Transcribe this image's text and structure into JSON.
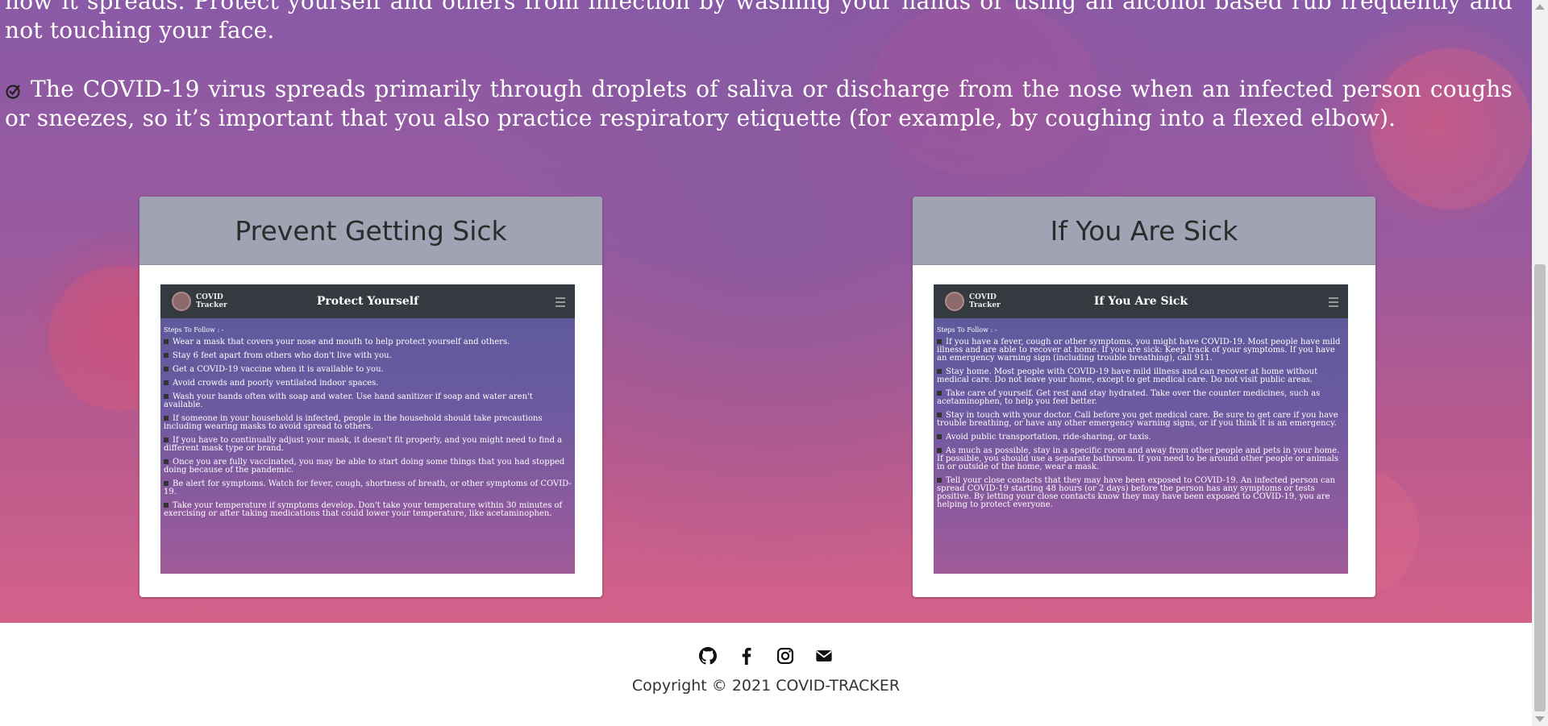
{
  "paragraphs": {
    "p1": "how it spreads. Protect yourself and others from infection by washing your hands or using an alcohol based rub frequently and not touching your face.",
    "p2": "The COVID-19 virus spreads primarily through droplets of saliva or discharge from the nose when an infected person coughs or sneezes, so it’s important that you also practice respiratory etiquette (for example, by coughing into a flexed elbow)."
  },
  "cards": {
    "prevent": {
      "title": "Prevent Getting Sick",
      "screenshot": {
        "brand": "COVID Tracker",
        "heading": "Protect Yourself",
        "steps_label": "Steps To Follow : -",
        "items": [
          "Wear a mask that covers your nose and mouth to help protect yourself and others.",
          "Stay 6 feet apart from others who don't live with you.",
          "Get a COVID-19 vaccine when it is available to you.",
          "Avoid crowds and poorly ventilated indoor spaces.",
          "Wash your hands often with soap and water. Use hand sanitizer if soap and water aren't available.",
          "If someone in your household is infected, people in the household should take precautions including wearing masks to avoid spread to others.",
          "If you have to continually adjust your mask, it doesn't fit properly, and you might need to find a different mask type or brand.",
          "Once you are fully vaccinated, you may be able to start doing some things that you had stopped doing because of the pandemic.",
          "Be alert for symptoms. Watch for fever, cough, shortness of breath, or other symptoms of COVID-19.",
          "Take your temperature if symptoms develop. Don't take your temperature within 30 minutes of exercising or after taking medications that could lower your temperature, like acetaminophen."
        ]
      }
    },
    "sick": {
      "title": "If You Are Sick",
      "screenshot": {
        "brand": "COVID Tracker",
        "heading": "If You Are Sick",
        "steps_label": "Steps To Follow : -",
        "items": [
          "If you have a fever, cough or other symptoms, you might have COVID-19. Most people have mild illness and are able to recover at home. If you are sick: Keep track of your symptoms. If you have an emergency warning sign (including trouble breathing), call 911.",
          "Stay home. Most people with COVID-19 have mild illness and can recover at home without medical care. Do not leave your home, except to get medical care. Do not visit public areas.",
          "Take care of yourself. Get rest and stay hydrated. Take over the counter medicines, such as acetaminophen, to help you feel better.",
          "Stay in touch with your doctor. Call before you get medical care. Be sure to get care if you have trouble breathing, or have any other emergency warning signs, or if you think it is an emergency.",
          "Avoid public transportation, ride-sharing, or taxis.",
          "As much as possible, stay in a specific room and away from other people and pets in your home. If possible, you should use a separate bathroom. If you need to be around other people or animals in or outside of the home, wear a mask.",
          "Tell your close contacts that they may have been exposed to COVID-19. An infected person can spread COVID-19 starting 48 hours (or 2 days) before the person has any symptoms or tests positive. By letting your close contacts know they may have been exposed to COVID-19, you are helping to protect everyone."
        ]
      }
    }
  },
  "footer": {
    "icons": [
      "github-icon",
      "facebook-icon",
      "instagram-icon",
      "email-icon"
    ],
    "copyright": "Copyright © 2021 COVID-TRACKER"
  }
}
